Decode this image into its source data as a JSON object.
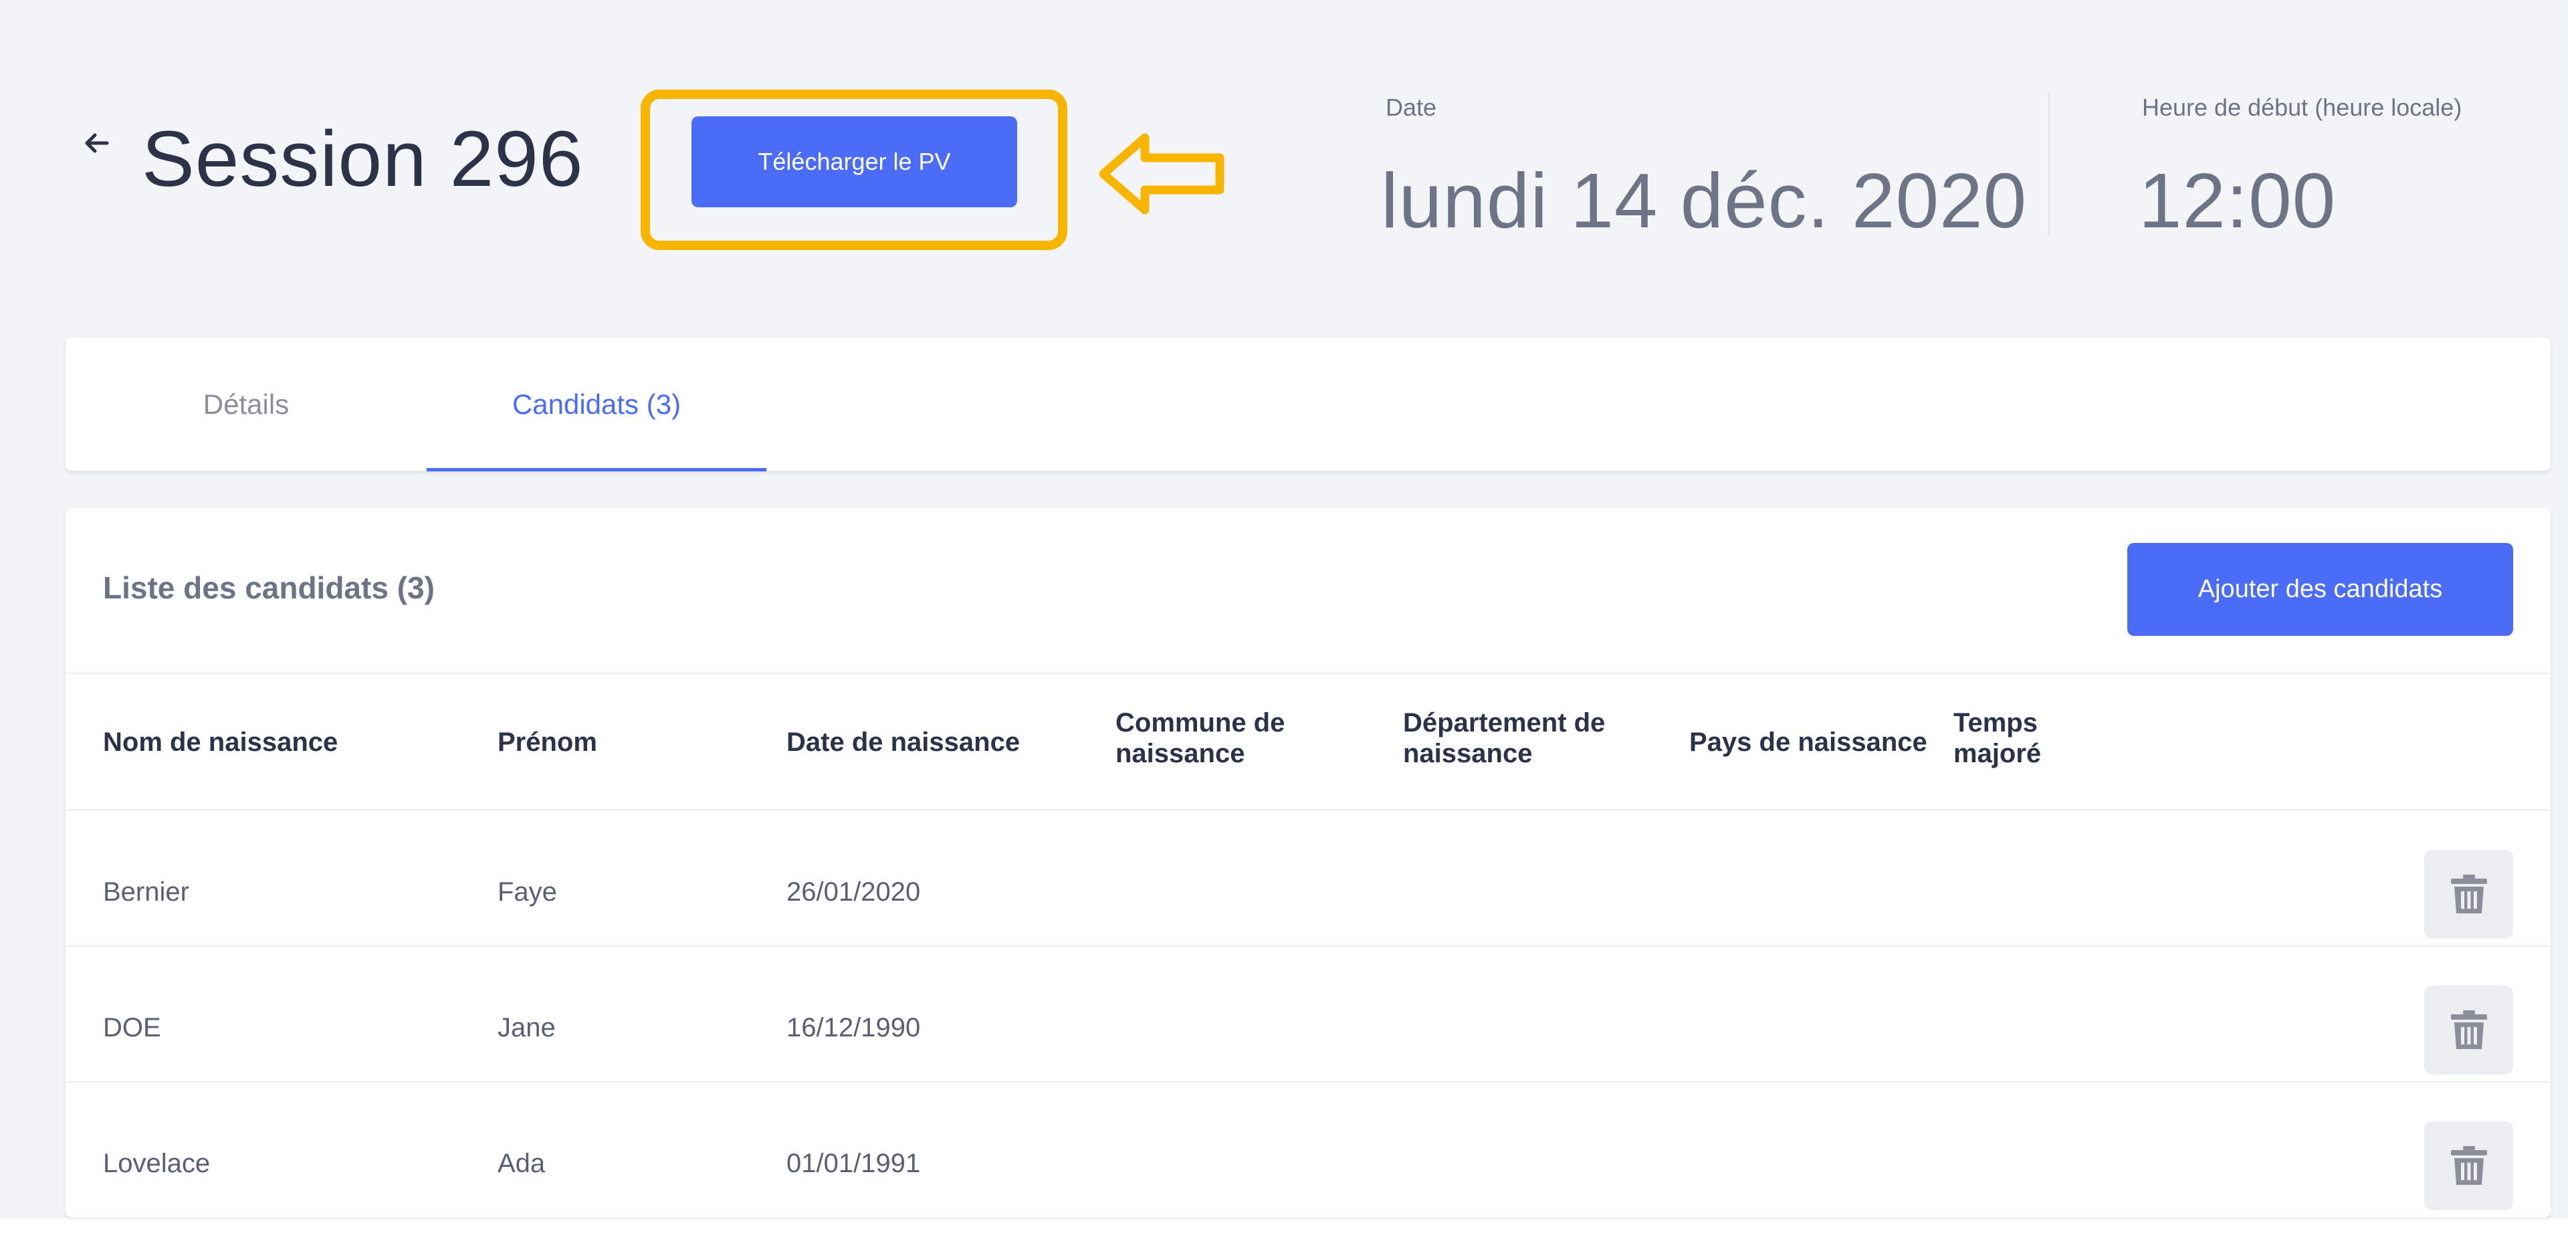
{
  "header": {
    "back_label": "←",
    "title": "Session 296",
    "download_button": "Télécharger le PV",
    "date_label": "Date",
    "date_value": "lundi 14 déc. 2020",
    "start_time_label": "Heure de début (heure locale)",
    "start_time_value": "12:00"
  },
  "tabs": [
    {
      "label": "Détails",
      "active": false
    },
    {
      "label": "Candidats (3)",
      "active": true
    }
  ],
  "candidates": {
    "title": "Liste des candidats (3)",
    "add_button": "Ajouter des candidats",
    "columns": [
      {
        "line1": "Nom de naissance",
        "line2": ""
      },
      {
        "line1": "Prénom",
        "line2": ""
      },
      {
        "line1": "Date de naissance",
        "line2": ""
      },
      {
        "line1": "Commune de",
        "line2": "naissance"
      },
      {
        "line1": "Département de",
        "line2": "naissance"
      },
      {
        "line1": "Pays de naissance",
        "line2": ""
      },
      {
        "line1": "Temps",
        "line2": "majoré"
      }
    ],
    "rows": [
      {
        "nom": "Bernier",
        "prenom": "Faye",
        "date_naissance": "26/01/2020"
      },
      {
        "nom": "DOE",
        "prenom": "Jane",
        "date_naissance": "16/12/1990"
      },
      {
        "nom": "Lovelace",
        "prenom": "Ada",
        "date_naissance": "01/01/1991"
      }
    ]
  },
  "colors": {
    "accent": "#4a6cf7",
    "highlight": "#f7b500",
    "text_dark": "#2c3248",
    "text_muted": "#6c7486",
    "background": "#f3f4f6"
  },
  "icons": {
    "back": "arrow-left-icon",
    "annotation": "hollow-arrow-left-icon",
    "delete": "trash-icon"
  }
}
